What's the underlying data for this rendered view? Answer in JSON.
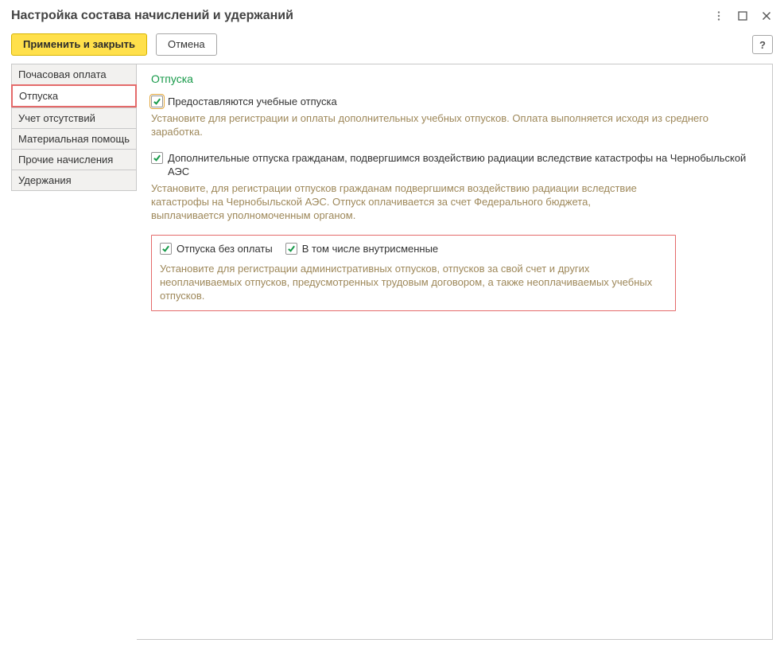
{
  "titlebar": {
    "title": "Настройка состава начислений и удержаний"
  },
  "toolbar": {
    "apply_close_label": "Применить и закрыть",
    "cancel_label": "Отмена",
    "help_label": "?"
  },
  "sidebar": {
    "items": [
      {
        "label": "Почасовая оплата"
      },
      {
        "label": "Отпуска"
      },
      {
        "label": "Учет отсутствий"
      },
      {
        "label": "Материальная помощь"
      },
      {
        "label": "Прочие начисления"
      },
      {
        "label": "Удержания"
      }
    ],
    "active_index": 1
  },
  "content": {
    "heading": "Отпуска",
    "opt1": {
      "label": "Предоставляются учебные отпуска",
      "desc": "Установите для регистрации и оплаты дополнительных учебных отпусков. Оплата выполняется исходя из среднего заработка."
    },
    "opt2": {
      "label": "Дополнительные отпуска гражданам, подвергшимся воздействию радиации вследствие катастрофы на Чернобыльской АЭС",
      "desc": "Установите, для регистрации отпусков гражданам подвергшимся воздействию радиации вследствие катастрофы на Чернобыльской АЭС. Отпуск оплачивается за счет Федерального бюджета, выплачивается уполномоченным органом."
    },
    "opt3": {
      "label": "Отпуска без оплаты",
      "sublabel": "В том числе внутрисменные",
      "desc": "Установите для регистрации административных отпусков, отпусков за свой счет и других неоплачиваемых отпусков, предусмотренных трудовым договором, а также неоплачиваемых учебных отпусков."
    }
  }
}
